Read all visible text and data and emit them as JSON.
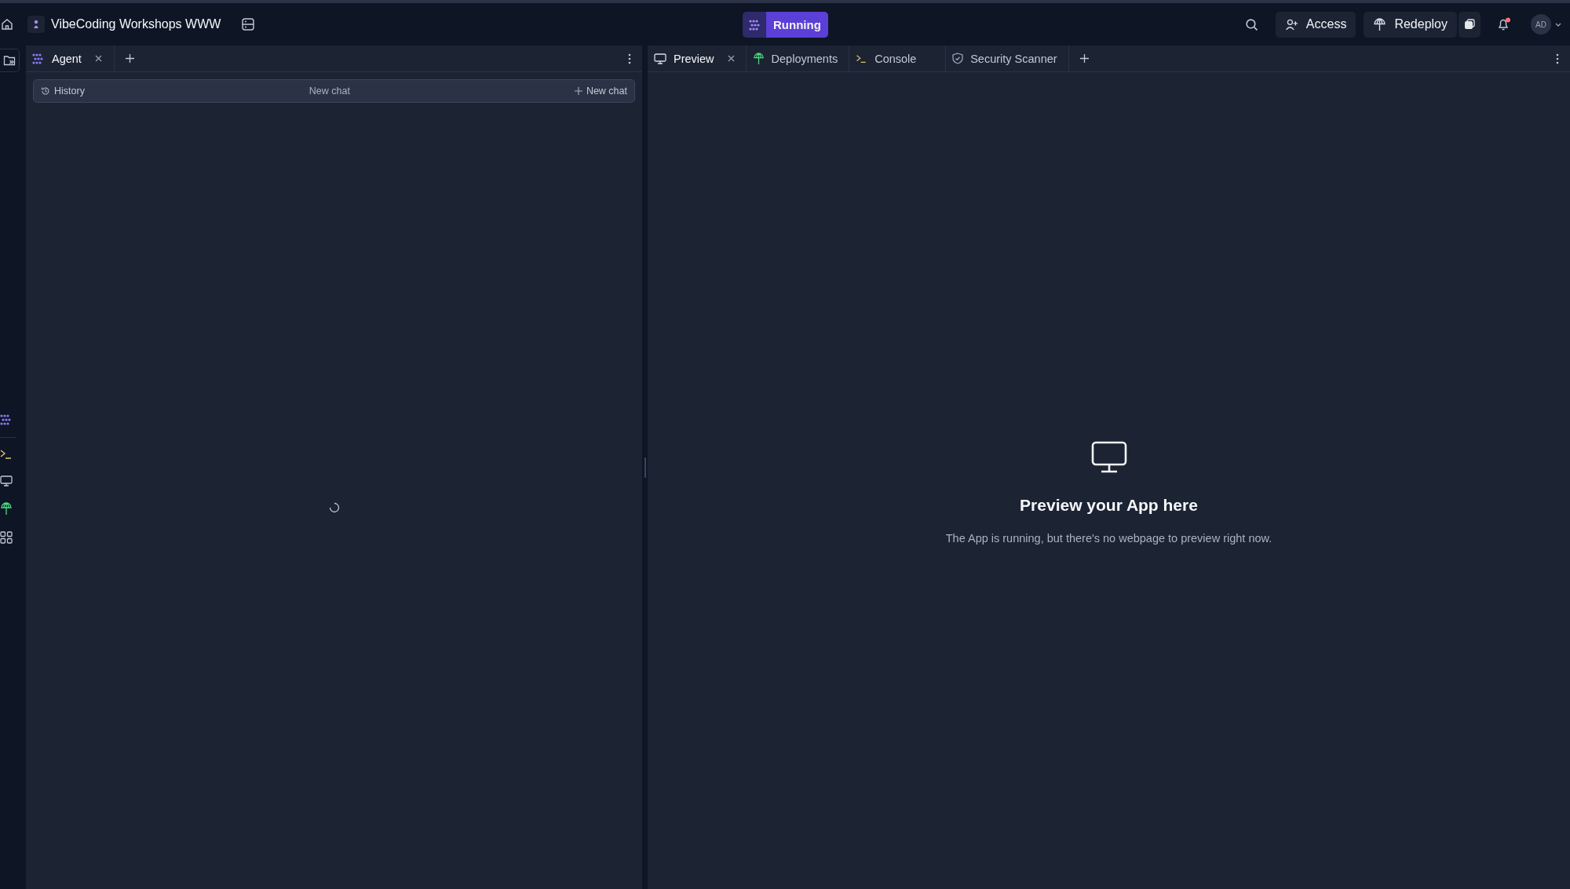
{
  "header": {
    "project_name": "VibeCoding Workshops WWW",
    "status": "Running",
    "avatar_initials": "AD",
    "buttons": [
      {
        "kind": "access",
        "label": "Access"
      },
      {
        "kind": "redeploy",
        "label": "Redeploy"
      }
    ]
  },
  "left_pane": {
    "tabs": [
      {
        "kind": "agent",
        "label": "Agent",
        "selected": true,
        "closable": true
      }
    ],
    "history_bar": {
      "history_label": "History",
      "title": "New chat",
      "new_chat_label": "New chat"
    }
  },
  "right_pane": {
    "tabs": [
      {
        "kind": "preview",
        "label": "Preview",
        "selected": true,
        "closable": true
      },
      {
        "kind": "deployments",
        "label": "Deployments",
        "selected": false,
        "closable": false
      },
      {
        "kind": "console",
        "label": "Console",
        "selected": false,
        "closable": false
      },
      {
        "kind": "security",
        "label": "Security Scanner",
        "selected": false,
        "closable": false
      }
    ],
    "empty_state": {
      "title": "Preview your App here",
      "message": "The App is running, but there's no webpage to preview right now."
    }
  }
}
